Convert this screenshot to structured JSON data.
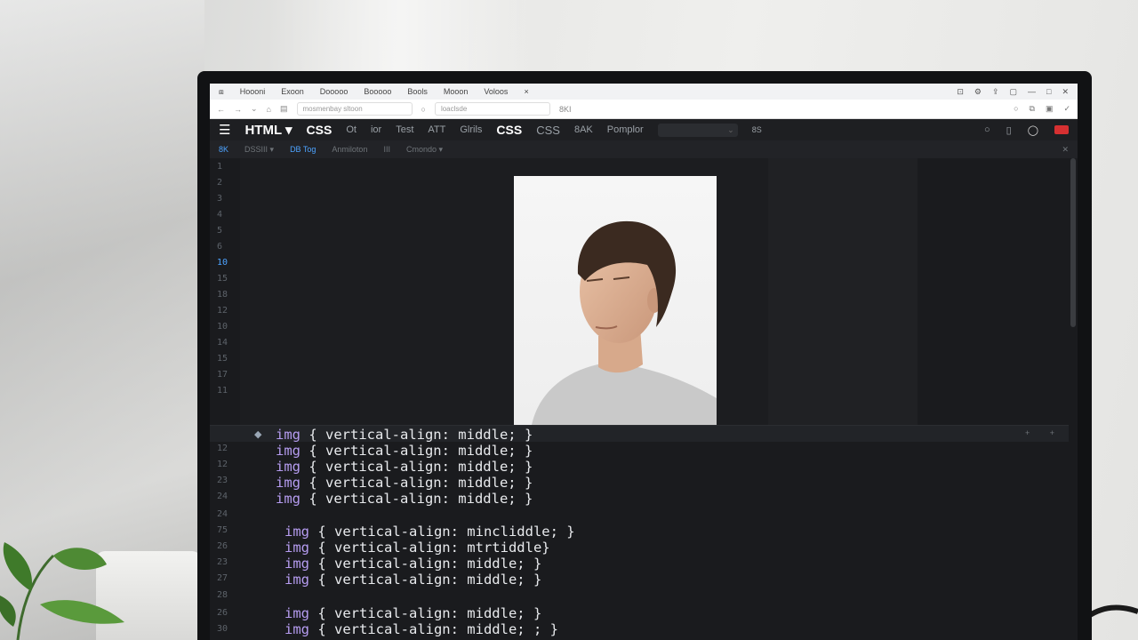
{
  "menubar": {
    "items": [
      "Hoooni",
      "Exoon",
      "Dooooo",
      "Booooo",
      "Bools",
      "Mooon",
      "Voloos"
    ],
    "icons": [
      "window-icon",
      "minimize-icon",
      "maximize-icon",
      "close-icon"
    ]
  },
  "addressbar": {
    "url": "mosmenbay sltoon",
    "search": "loaclsde",
    "extra": "8KI"
  },
  "toolbar": {
    "menu_icon": "hamburger-icon",
    "brand": "HTML",
    "css_label": "CSS",
    "items": [
      "Ot",
      "ior",
      "Test",
      "ATT",
      "Glrils"
    ],
    "css_bold": "CSS",
    "css_plain": "CSS",
    "size": "8AK",
    "sampler": "Pomplor",
    "select": "",
    "badge": "8S"
  },
  "tabs": {
    "icon": "8K",
    "items": [
      "DSSIII",
      "DB Tog",
      "Anmiloton",
      "III",
      "Cmondo"
    ]
  },
  "gutter": {
    "top_lines": [
      "1",
      "2",
      "3",
      "4",
      "5",
      "6",
      "10",
      "15",
      "18",
      "12",
      "10",
      "14",
      "15",
      "17",
      "11"
    ],
    "bottom_lines": [
      "19",
      "12",
      "12",
      "23",
      "24",
      "24",
      "75",
      "26",
      "23",
      "27",
      "28",
      "26",
      "30"
    ]
  },
  "code": {
    "lines": [
      {
        "sel": "img",
        "rest": " { vertical-align: middle; }"
      },
      {
        "sel": "img",
        "rest": " { vertical-align: middle; }"
      },
      {
        "sel": "img",
        "rest": " { vertical-align: middle; }"
      },
      {
        "sel": "img",
        "rest": " { vertical-align: middle; }"
      },
      {
        "sel": "img",
        "rest": " { vertical-align: middle; }"
      },
      {
        "sel": "img",
        "rest": " { vertical-align: mincliddle; }"
      },
      {
        "sel": "img",
        "rest": " { vertical-align: mtrtiddle}"
      },
      {
        "sel": "img",
        "rest": " { vertical-align: middle; }"
      },
      {
        "sel": "img",
        "rest": " { vertical-align: middle; }"
      },
      {
        "sel": "img",
        "rest": " { vertical-align: middle; }"
      },
      {
        "sel": "img",
        "rest": " { vertical-align: middle; ; }"
      }
    ]
  },
  "colors": {
    "accent": "#4da3ff",
    "selector": "#b59cf0",
    "record": "#d63031"
  }
}
